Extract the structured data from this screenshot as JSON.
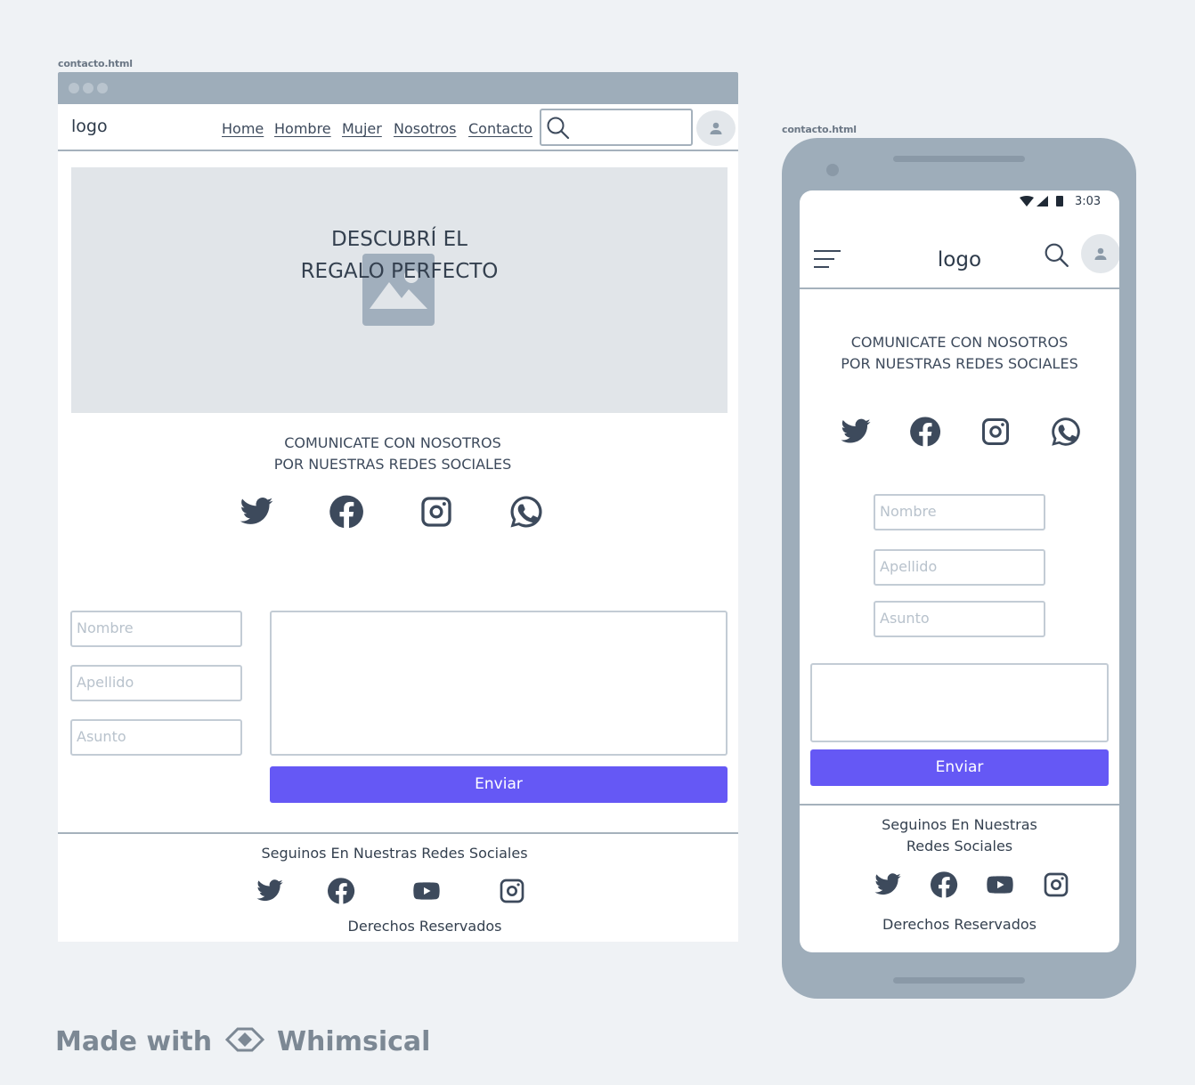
{
  "desktop": {
    "file_label": "contacto.html",
    "logo": "logo",
    "nav": [
      "Home",
      "Hombre",
      "Mujer",
      "Nosotros",
      "Contacto"
    ],
    "hero": {
      "line1": "DESCUBRÍ EL",
      "line2": "REGALO PERFECTO"
    },
    "social_heading": {
      "line1": "COMUNICATE CON NOSOTROS",
      "line2": "POR NUESTRAS REDES SOCIALES"
    },
    "form": {
      "nombre_placeholder": "Nombre",
      "apellido_placeholder": "Apellido",
      "asunto_placeholder": "Asunto",
      "submit_label": "Enviar"
    },
    "footer": {
      "heading": "Seguinos En Nuestras Redes Sociales",
      "rights": "Derechos Reservados"
    }
  },
  "mobile": {
    "file_label": "contacto.html",
    "status_time": "3:03",
    "logo": "logo",
    "social_heading": {
      "line1": "COMUNICATE CON NOSOTROS",
      "line2": "POR NUESTRAS REDES SOCIALES"
    },
    "form": {
      "nombre_placeholder": "Nombre",
      "apellido_placeholder": "Apellido",
      "asunto_placeholder": "Asunto",
      "submit_label": "Enviar"
    },
    "footer": {
      "heading_line1": "Seguinos En Nuestras",
      "heading_line2": "Redes Sociales",
      "rights": "Derechos Reservados"
    }
  },
  "branding": {
    "made_with": "Made with",
    "brand": "Whimsical"
  },
  "colors": {
    "accent": "#6558f5",
    "frame": "#9eadba",
    "icon": "#3d4a5c"
  },
  "icons": [
    "twitter-icon",
    "facebook-icon",
    "instagram-icon",
    "whatsapp-icon",
    "youtube-icon",
    "search-icon",
    "user-icon",
    "menu-icon",
    "image-icon",
    "whimsical-logo-icon"
  ]
}
